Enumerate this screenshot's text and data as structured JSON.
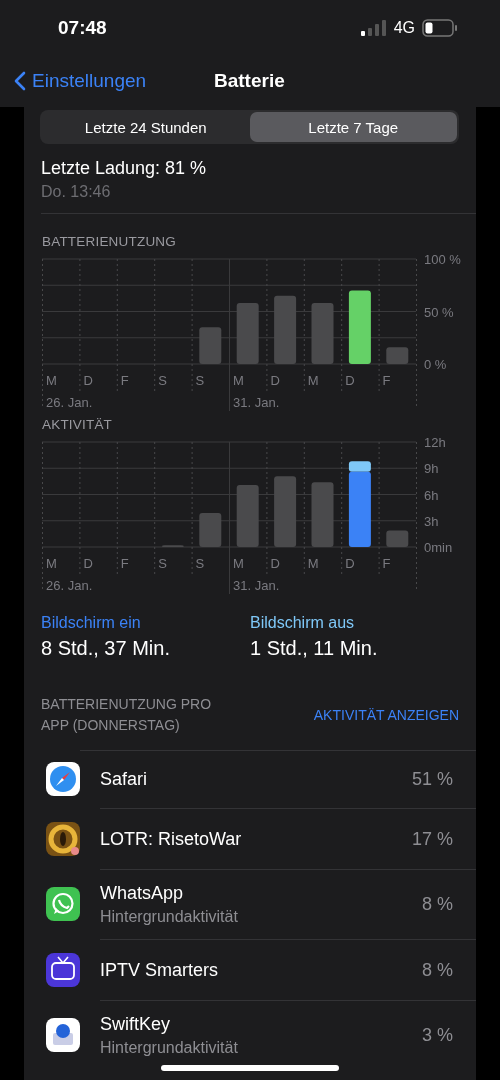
{
  "status_bar": {
    "time": "07:48",
    "network": "4G"
  },
  "nav": {
    "back": "Einstellungen",
    "title": "Batterie"
  },
  "tabs": [
    {
      "label": "Letzte 24 Stunden",
      "selected": false
    },
    {
      "label": "Letzte 7 Tage",
      "selected": true
    }
  ],
  "last_charge": {
    "title": "Letzte Ladung: 81 %",
    "time": "Do. 13:46"
  },
  "charts": [
    {
      "title": "BATTERIENUTZUNG",
      "date_labels": [
        "26. Jan.",
        "31. Jan."
      ],
      "chart_data": {
        "type": "bar",
        "categories": [
          "M",
          "D",
          "F",
          "S",
          "S",
          "M",
          "D",
          "M",
          "D",
          "F"
        ],
        "stacked": true,
        "grid": true,
        "ylim": [
          0,
          100
        ],
        "yticks": [
          {
            "value": 0,
            "label": "0 %"
          },
          {
            "value": 50,
            "label": "50 %"
          },
          {
            "value": 100,
            "label": "100 %"
          }
        ],
        "series": [
          {
            "color": "#4a4a4c",
            "values": [
              null,
              null,
              null,
              null,
              35,
              58,
              65,
              58,
              null,
              16
            ]
          },
          {
            "color": "#65d167",
            "values": [
              null,
              null,
              null,
              null,
              null,
              null,
              null,
              null,
              70,
              null
            ]
          }
        ]
      }
    },
    {
      "title": "AKTIVITÄT",
      "date_labels": [
        "26. Jan.",
        "31. Jan."
      ],
      "chart_data": {
        "type": "bar",
        "categories": [
          "M",
          "D",
          "F",
          "S",
          "S",
          "M",
          "D",
          "M",
          "D",
          "F"
        ],
        "stacked": true,
        "grid": true,
        "ylim": [
          0,
          12
        ],
        "yticks": [
          {
            "value": 0,
            "label": "0min"
          },
          {
            "value": 3,
            "label": "3h"
          },
          {
            "value": 6,
            "label": "6h"
          },
          {
            "value": 9,
            "label": "9h"
          },
          {
            "value": 12,
            "label": "12h"
          }
        ],
        "series": [
          {
            "color": "#4a4a4c",
            "values": [
              null,
              null,
              null,
              0.2,
              3.9,
              7.1,
              8.1,
              7.4,
              null,
              1.9
            ]
          },
          {
            "color": "#3b82f6",
            "values": [
              null,
              null,
              null,
              null,
              null,
              null,
              null,
              null,
              8.6,
              null
            ]
          },
          {
            "color": "#7fc8f8",
            "values": [
              null,
              null,
              null,
              null,
              null,
              null,
              null,
              null,
              1.2,
              null
            ]
          }
        ]
      }
    }
  ],
  "screen_times": [
    {
      "label": "Bildschirm ein",
      "value": "8 Std., 37 Min.",
      "color": "#3b82f6"
    },
    {
      "label": "Bildschirm aus",
      "value": "1 Std., 11 Min.",
      "color": "#7fc8f8"
    }
  ],
  "apps_header": {
    "title": "BATTERIENUTZUNG PRO APP (DONNERSTAG)",
    "link": "AKTIVITÄT ANZEIGEN"
  },
  "apps": [
    {
      "kind": "compass",
      "name": "Safari",
      "percent": "51 %"
    },
    {
      "kind": "ring",
      "name": "LOTR: RisetoWar",
      "percent": "17 %"
    },
    {
      "kind": "chat",
      "name": "WhatsApp",
      "subtitle": "Hintergrundaktivität",
      "percent": "8 %"
    },
    {
      "kind": "tv",
      "name": "IPTV Smarters",
      "percent": "8 %"
    },
    {
      "kind": "keyboard",
      "name": "SwiftKey",
      "subtitle": "Hintergrundaktivität",
      "percent": "3 %"
    }
  ]
}
